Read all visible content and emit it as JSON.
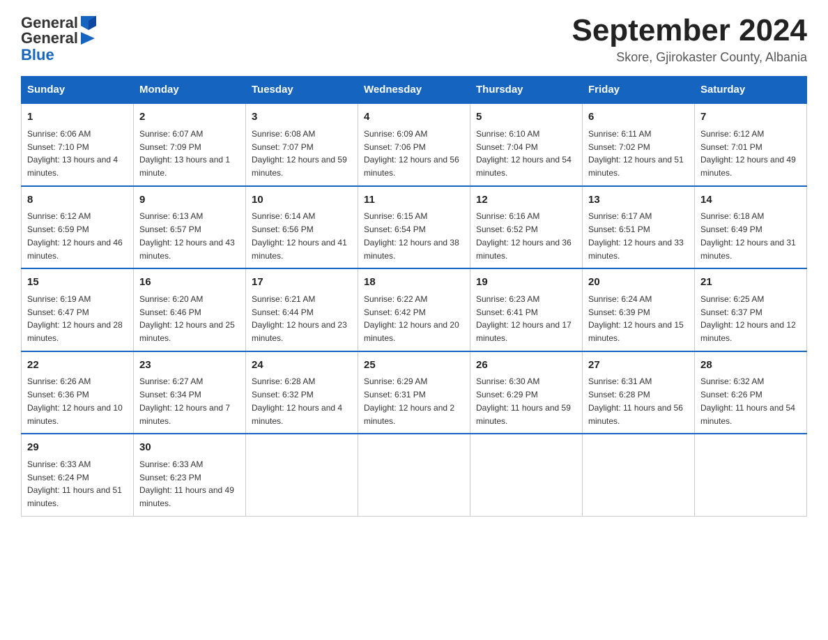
{
  "header": {
    "logo": {
      "general": "General",
      "blue": "Blue"
    },
    "title": "September 2024",
    "subtitle": "Skore, Gjirokaster County, Albania"
  },
  "days_of_week": [
    "Sunday",
    "Monday",
    "Tuesday",
    "Wednesday",
    "Thursday",
    "Friday",
    "Saturday"
  ],
  "weeks": [
    [
      {
        "day": "1",
        "sunrise": "6:06 AM",
        "sunset": "7:10 PM",
        "daylight": "13 hours and 4 minutes."
      },
      {
        "day": "2",
        "sunrise": "6:07 AM",
        "sunset": "7:09 PM",
        "daylight": "13 hours and 1 minute."
      },
      {
        "day": "3",
        "sunrise": "6:08 AM",
        "sunset": "7:07 PM",
        "daylight": "12 hours and 59 minutes."
      },
      {
        "day": "4",
        "sunrise": "6:09 AM",
        "sunset": "7:06 PM",
        "daylight": "12 hours and 56 minutes."
      },
      {
        "day": "5",
        "sunrise": "6:10 AM",
        "sunset": "7:04 PM",
        "daylight": "12 hours and 54 minutes."
      },
      {
        "day": "6",
        "sunrise": "6:11 AM",
        "sunset": "7:02 PM",
        "daylight": "12 hours and 51 minutes."
      },
      {
        "day": "7",
        "sunrise": "6:12 AM",
        "sunset": "7:01 PM",
        "daylight": "12 hours and 49 minutes."
      }
    ],
    [
      {
        "day": "8",
        "sunrise": "6:12 AM",
        "sunset": "6:59 PM",
        "daylight": "12 hours and 46 minutes."
      },
      {
        "day": "9",
        "sunrise": "6:13 AM",
        "sunset": "6:57 PM",
        "daylight": "12 hours and 43 minutes."
      },
      {
        "day": "10",
        "sunrise": "6:14 AM",
        "sunset": "6:56 PM",
        "daylight": "12 hours and 41 minutes."
      },
      {
        "day": "11",
        "sunrise": "6:15 AM",
        "sunset": "6:54 PM",
        "daylight": "12 hours and 38 minutes."
      },
      {
        "day": "12",
        "sunrise": "6:16 AM",
        "sunset": "6:52 PM",
        "daylight": "12 hours and 36 minutes."
      },
      {
        "day": "13",
        "sunrise": "6:17 AM",
        "sunset": "6:51 PM",
        "daylight": "12 hours and 33 minutes."
      },
      {
        "day": "14",
        "sunrise": "6:18 AM",
        "sunset": "6:49 PM",
        "daylight": "12 hours and 31 minutes."
      }
    ],
    [
      {
        "day": "15",
        "sunrise": "6:19 AM",
        "sunset": "6:47 PM",
        "daylight": "12 hours and 28 minutes."
      },
      {
        "day": "16",
        "sunrise": "6:20 AM",
        "sunset": "6:46 PM",
        "daylight": "12 hours and 25 minutes."
      },
      {
        "day": "17",
        "sunrise": "6:21 AM",
        "sunset": "6:44 PM",
        "daylight": "12 hours and 23 minutes."
      },
      {
        "day": "18",
        "sunrise": "6:22 AM",
        "sunset": "6:42 PM",
        "daylight": "12 hours and 20 minutes."
      },
      {
        "day": "19",
        "sunrise": "6:23 AM",
        "sunset": "6:41 PM",
        "daylight": "12 hours and 17 minutes."
      },
      {
        "day": "20",
        "sunrise": "6:24 AM",
        "sunset": "6:39 PM",
        "daylight": "12 hours and 15 minutes."
      },
      {
        "day": "21",
        "sunrise": "6:25 AM",
        "sunset": "6:37 PM",
        "daylight": "12 hours and 12 minutes."
      }
    ],
    [
      {
        "day": "22",
        "sunrise": "6:26 AM",
        "sunset": "6:36 PM",
        "daylight": "12 hours and 10 minutes."
      },
      {
        "day": "23",
        "sunrise": "6:27 AM",
        "sunset": "6:34 PM",
        "daylight": "12 hours and 7 minutes."
      },
      {
        "day": "24",
        "sunrise": "6:28 AM",
        "sunset": "6:32 PM",
        "daylight": "12 hours and 4 minutes."
      },
      {
        "day": "25",
        "sunrise": "6:29 AM",
        "sunset": "6:31 PM",
        "daylight": "12 hours and 2 minutes."
      },
      {
        "day": "26",
        "sunrise": "6:30 AM",
        "sunset": "6:29 PM",
        "daylight": "11 hours and 59 minutes."
      },
      {
        "day": "27",
        "sunrise": "6:31 AM",
        "sunset": "6:28 PM",
        "daylight": "11 hours and 56 minutes."
      },
      {
        "day": "28",
        "sunrise": "6:32 AM",
        "sunset": "6:26 PM",
        "daylight": "11 hours and 54 minutes."
      }
    ],
    [
      {
        "day": "29",
        "sunrise": "6:33 AM",
        "sunset": "6:24 PM",
        "daylight": "11 hours and 51 minutes."
      },
      {
        "day": "30",
        "sunrise": "6:33 AM",
        "sunset": "6:23 PM",
        "daylight": "11 hours and 49 minutes."
      },
      null,
      null,
      null,
      null,
      null
    ]
  ]
}
